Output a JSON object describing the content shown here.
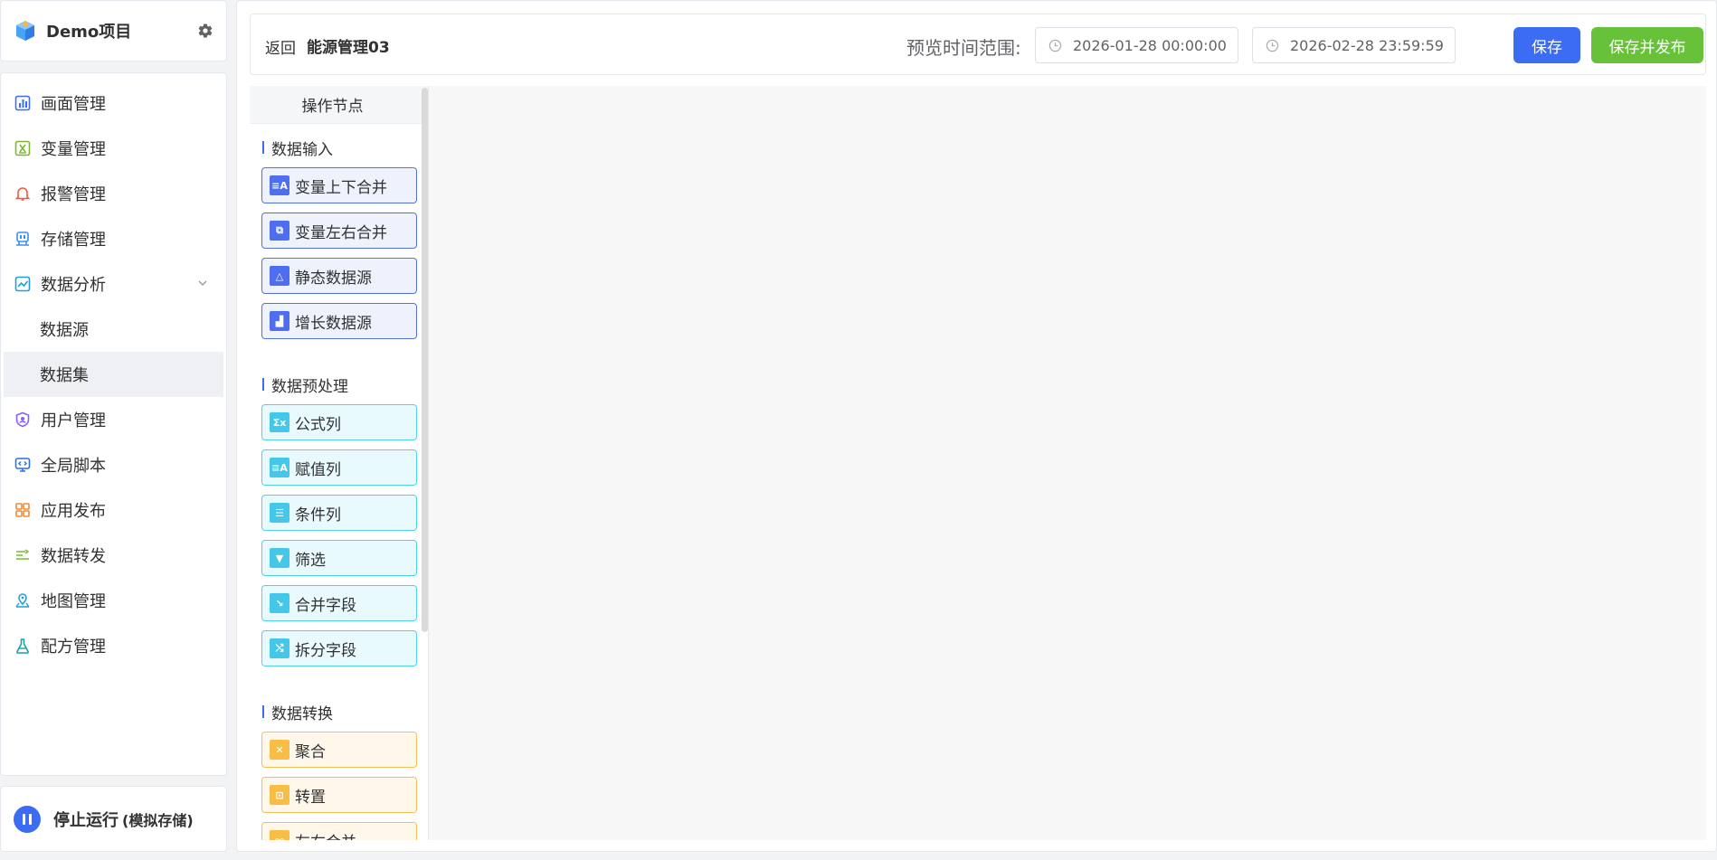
{
  "sidebar": {
    "project_name": "Demo项目",
    "menu": [
      {
        "label": "画面管理",
        "icon": "chart-bar-icon"
      },
      {
        "label": "变量管理",
        "icon": "variable-icon"
      },
      {
        "label": "报警管理",
        "icon": "bell-icon"
      },
      {
        "label": "存储管理",
        "icon": "storage-icon"
      },
      {
        "label": "数据分析",
        "icon": "trend-chart-icon"
      },
      {
        "label": "数据源"
      },
      {
        "label": "数据集"
      },
      {
        "label": "用户管理",
        "icon": "shield-user-icon"
      },
      {
        "label": "全局脚本",
        "icon": "monitor-code-icon"
      },
      {
        "label": "应用发布",
        "icon": "grid-apps-icon"
      },
      {
        "label": "数据转发",
        "icon": "forward-icon"
      },
      {
        "label": "地图管理",
        "icon": "map-icon"
      },
      {
        "label": "配方管理",
        "icon": "flask-icon"
      }
    ],
    "run_status": "停止运行",
    "run_mode": "(模拟存储)"
  },
  "header": {
    "back_label": "返回",
    "page_title": "能源管理03",
    "range_label": "预览时间范围:",
    "start_time": "2026-01-28 00:00:00",
    "end_time": "2026-02-28 23:59:59",
    "save_label": "保存",
    "publish_label": "保存并发布"
  },
  "node_panel": {
    "title": "操作节点",
    "groups": [
      {
        "title": "数据输入",
        "items": [
          "变量上下合并",
          "变量左右合并",
          "静态数据源",
          "增长数据源"
        ]
      },
      {
        "title": "数据预处理",
        "items": [
          "公式列",
          "赋值列",
          "条件列",
          "筛选",
          "合并字段",
          "拆分字段"
        ]
      },
      {
        "title": "数据转换",
        "items": [
          "聚合",
          "转置",
          "左右合并"
        ]
      }
    ]
  },
  "colors": {
    "primary": "#3c6cf3",
    "success": "#67c23a",
    "input_node": "#4e6ef0",
    "preprocess_node": "#44c7e8",
    "transform_node": "#f7bd44"
  }
}
